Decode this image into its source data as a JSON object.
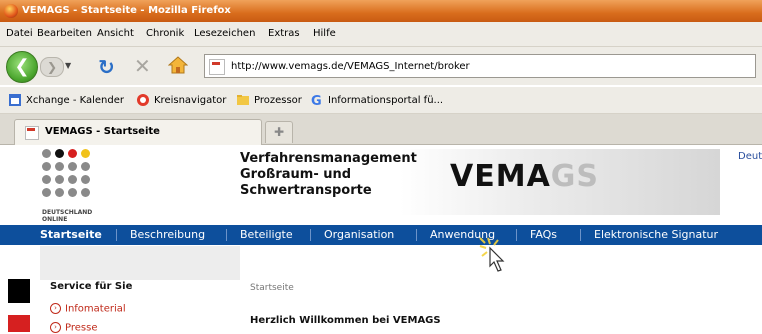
{
  "window": {
    "title": "VEMAGS - Startseite - Mozilla Firefox"
  },
  "menu": [
    "Datei",
    "Bearbeiten",
    "Ansicht",
    "Chronik",
    "Lesezeichen",
    "Extras",
    "Hilfe"
  ],
  "address": {
    "url": "http://www.vemags.de/VEMAGS_Internet/broker"
  },
  "bookmarks": [
    {
      "label": "Xchange - Kalender",
      "icon": "calendar-icon"
    },
    {
      "label": "Kreisnavigator",
      "icon": "lifebuoy-icon"
    },
    {
      "label": "Prozessor",
      "icon": "folder-icon"
    },
    {
      "label": "Informationsportal fü...",
      "icon": "google-icon"
    }
  ],
  "tab": {
    "label": "VEMAGS - Startseite"
  },
  "page": {
    "brand_line1": "DEUTSCHLAND",
    "brand_line2": "ONLINE",
    "title_line1": "Verfahrensmanagement",
    "title_line2": "Großraum- und",
    "title_line3": "Schwertransporte",
    "logo_a": "VEMA",
    "logo_b": "GS",
    "lang_link": "Deut",
    "nav": [
      "Startseite",
      "Beschreibung",
      "Beteiligte",
      "Organisation",
      "Anwendung",
      "FAQs",
      "Elektronische Signatur"
    ],
    "sidebar_heading": "Service für Sie",
    "sidebar_items": [
      "Infomaterial",
      "Presse"
    ],
    "breadcrumb": "Startseite",
    "welcome": "Herzlich Willkommen bei VEMAGS"
  },
  "colors": {
    "nav_blue": "#0d4f9c",
    "link_red": "#c02a1a",
    "title_orange": "#d96d1d"
  }
}
